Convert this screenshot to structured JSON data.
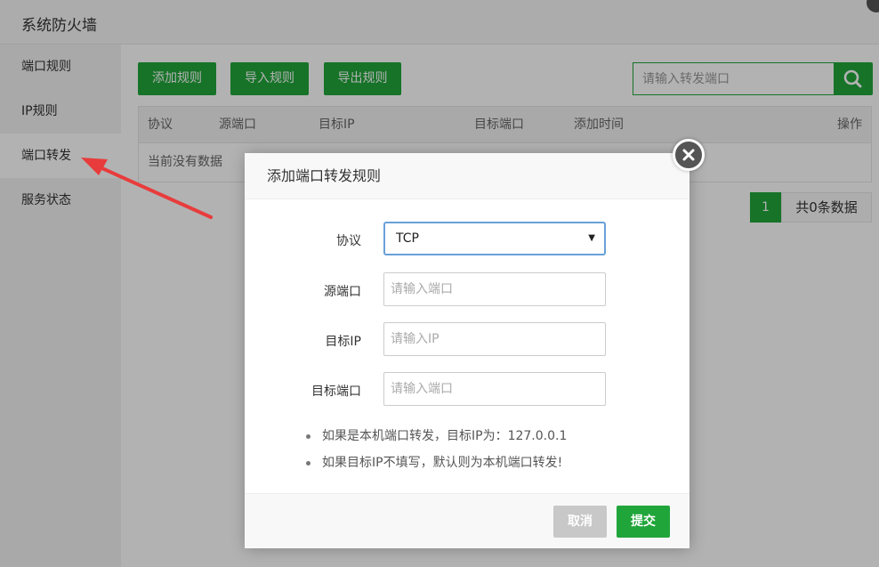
{
  "app": {
    "title": "系统防火墙"
  },
  "sidebar": {
    "items": [
      {
        "label": "端口规则"
      },
      {
        "label": "IP规则"
      },
      {
        "label": "端口转发"
      },
      {
        "label": "服务状态"
      }
    ],
    "active": "端口转发"
  },
  "toolbar": {
    "add_label": "添加规则",
    "import_label": "导入规则",
    "export_label": "导出规则",
    "search_placeholder": "请输入转发端口"
  },
  "table": {
    "columns": [
      "协议",
      "源端口",
      "目标IP",
      "目标端口",
      "添加时间",
      "操作"
    ],
    "empty_text": "当前没有数据"
  },
  "pagination": {
    "current": "1",
    "summary": "共0条数据"
  },
  "modal": {
    "title": "添加端口转发规则",
    "fields": {
      "protocol": {
        "label": "协议",
        "value": "TCP"
      },
      "source_port": {
        "label": "源端口",
        "placeholder": "请输入端口"
      },
      "target_ip": {
        "label": "目标IP",
        "placeholder": "请输入IP"
      },
      "target_port": {
        "label": "目标端口",
        "placeholder": "请输入端口"
      }
    },
    "tips": [
      "如果是本机端口转发，目标IP为：127.0.0.1",
      "如果目标IP不填写，默认则为本机端口转发!"
    ],
    "cancel_label": "取消",
    "submit_label": "提交"
  },
  "colors": {
    "accent": "#20a53a",
    "annotation_arrow": "#e83c3c",
    "overlay": "rgba(0,0,0,0.3)"
  },
  "icons": {
    "search": "search-icon",
    "close": "close-icon",
    "dropdown": "chevron-down-icon"
  }
}
